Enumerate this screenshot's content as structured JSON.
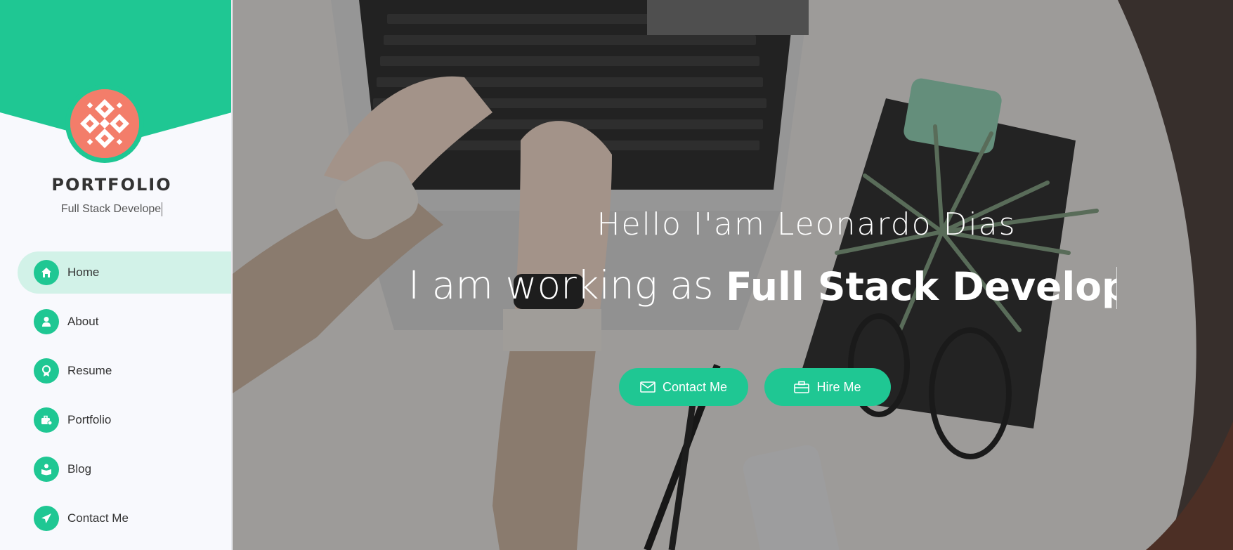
{
  "sidebar": {
    "brand": "PORTFOLIO",
    "tagline": "Full Stack Develope",
    "accent": "#1fc793",
    "items": [
      {
        "label": "Home",
        "icon": "home-icon",
        "active": true
      },
      {
        "label": "About",
        "icon": "user-icon"
      },
      {
        "label": "Resume",
        "icon": "award-icon"
      },
      {
        "label": "Portfolio",
        "icon": "briefcase-icon"
      },
      {
        "label": "Blog",
        "icon": "book-reader-icon"
      },
      {
        "label": "Contact Me",
        "icon": "paper-plane-icon"
      }
    ]
  },
  "hero": {
    "greeting": "Hello I'am Leonardo Dias",
    "working_prefix": "I am working as",
    "role": "Full Stack Develope",
    "buttons": {
      "contact": "Contact Me",
      "hire": "Hire Me"
    }
  }
}
